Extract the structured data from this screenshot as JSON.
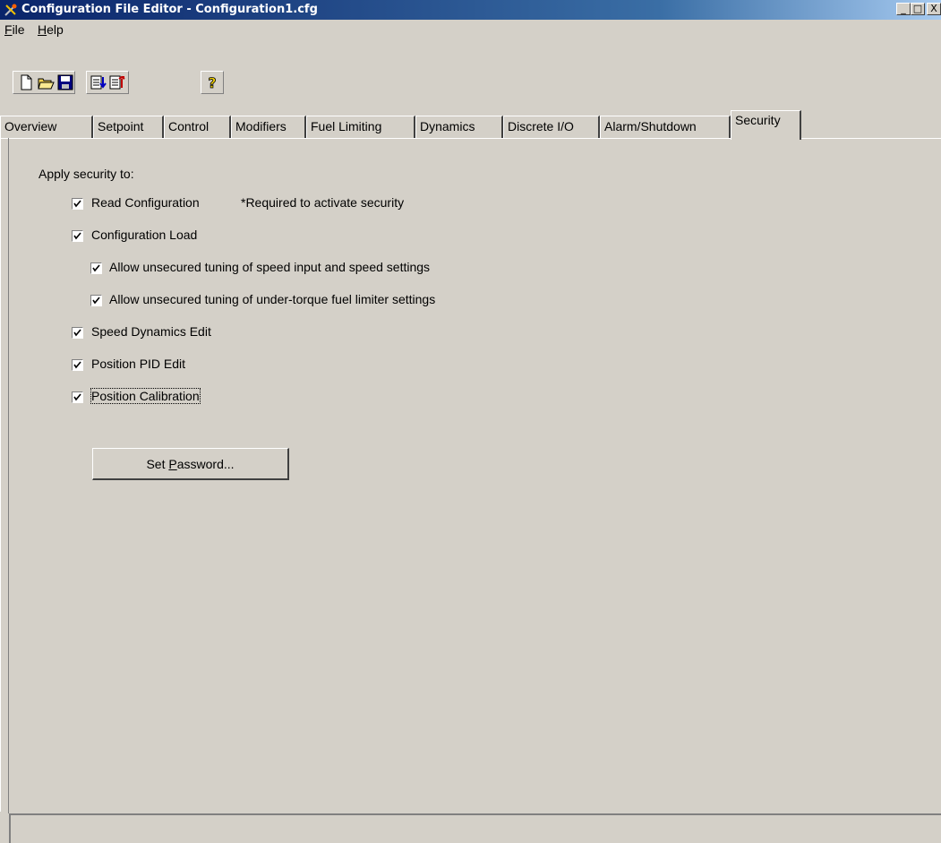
{
  "window": {
    "title": "Configuration File Editor - Configuration1.cfg",
    "minimize_glyph": "_",
    "maximize_glyph": "□",
    "close_glyph": "X"
  },
  "menu": {
    "items": [
      {
        "label": "File",
        "mnemonic": "F",
        "rest": "ile"
      },
      {
        "label": "Help",
        "mnemonic": "H",
        "rest": "elp"
      }
    ]
  },
  "toolbar": {
    "buttons": [
      {
        "icon": "new-file-icon"
      },
      {
        "icon": "open-folder-icon"
      },
      {
        "icon": "save-disk-icon"
      },
      {
        "icon": "associate-down-icon"
      },
      {
        "icon": "associate-up-icon"
      },
      {
        "icon": "help-question-icon"
      }
    ]
  },
  "tabs": [
    {
      "label": "Overview"
    },
    {
      "label": "Setpoint"
    },
    {
      "label": "Control"
    },
    {
      "label": "Modifiers"
    },
    {
      "label": "Fuel Limiting"
    },
    {
      "label": "Dynamics"
    },
    {
      "label": "Discrete I/O"
    },
    {
      "label": "Alarm/Shutdown"
    },
    {
      "label": "Security",
      "active": true
    }
  ],
  "security": {
    "heading": "Apply security to:",
    "options": [
      {
        "label": "Read Configuration",
        "note": "*Required to activate security",
        "checked": true
      },
      {
        "label": "Configuration Load",
        "checked": true
      },
      {
        "label": "Allow unsecured tuning of speed input and speed settings",
        "checked": true
      },
      {
        "label": "Allow unsecured tuning of under-torque fuel limiter settings",
        "checked": true
      },
      {
        "label": "Speed Dynamics Edit",
        "checked": true
      },
      {
        "label": "Position PID Edit",
        "checked": true
      },
      {
        "label": "Position Calibration",
        "checked": true
      }
    ],
    "set_password_button": {
      "prefix": "Set ",
      "mnemonic": "P",
      "rest": "assword..."
    }
  },
  "colors": {
    "face": "#d4d0c8",
    "title_start": "#0a246a",
    "title_end": "#a6caf0"
  }
}
